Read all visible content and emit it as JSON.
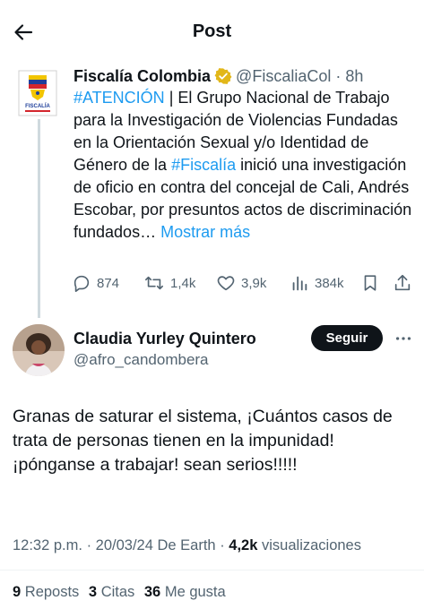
{
  "header": {
    "title": "Post"
  },
  "quoted_post": {
    "author_name": "Fiscalía Colombia",
    "handle": "@FiscaliaCol",
    "time": "8h",
    "logo_text": "FISCALÍA",
    "text_segments": [
      {
        "text": "#ATENCIÓN",
        "type": "hashtag"
      },
      {
        "text": " | El Grupo Nacional de Trabajo para la Investigación de Violencias Fundadas en la Orientación Sexual y/o Identidad de Género de la ",
        "type": "plain"
      },
      {
        "text": "#Fiscalía",
        "type": "hashtag"
      },
      {
        "text": " inició una investigación de oficio en contra del concejal de Cali, Andrés Escobar, por presuntos actos de discriminación fundados… ",
        "type": "plain"
      },
      {
        "text": "Mostrar más",
        "type": "link"
      }
    ],
    "actions": {
      "replies": "874",
      "reposts": "1,4k",
      "likes": "3,9k",
      "views": "384k"
    }
  },
  "reply_post": {
    "author_name": "Claudia Yurley Quintero",
    "handle": "@afro_candombera",
    "follow_label": "Seguir",
    "text": "Granas de saturar el sistema, ¡Cuántos casos de trata de personas tienen en la impunidad! ¡pónganse a trabajar! sean serios!!!!!",
    "time": "12:32 p.m.",
    "date": "20/03/24",
    "source": "De Earth",
    "views_count": "4,2k",
    "views_label": "visualizaciones",
    "reposts_count": "9",
    "reposts_label": "Reposts",
    "quotes_count": "3",
    "quotes_label": "Citas",
    "likes_count": "36",
    "likes_label": "Me gusta"
  },
  "colors": {
    "accent": "#1d9bf0",
    "text_primary": "#0f1419",
    "text_secondary": "#536471",
    "verified_gold": "#e2b719"
  }
}
